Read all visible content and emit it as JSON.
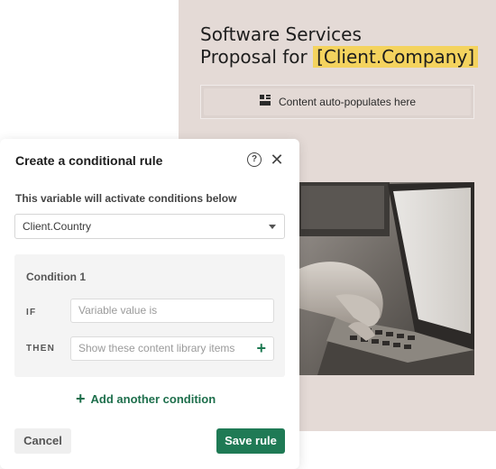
{
  "document": {
    "title_line1": "Software Services",
    "title_line2_prefix": "Proposal for ",
    "title_token": "[Client.Company]",
    "autopopulate_label": "Content auto-populates here"
  },
  "modal": {
    "title": "Create a conditional rule",
    "help_glyph": "?",
    "close_glyph": "✕",
    "variable_prompt": "This variable will activate conditions below",
    "variable_selected": "Client.Country",
    "condition": {
      "title": "Condition 1",
      "if_label": "IF",
      "if_placeholder": "Variable value is",
      "then_label": "THEN",
      "then_placeholder": "Show these content library items"
    },
    "add_condition_label": "Add another condition",
    "cancel_label": "Cancel",
    "save_label": "Save rule"
  },
  "colors": {
    "accent_green": "#1f7a55",
    "token_highlight": "#f4d35e",
    "doc_background": "#e4dad6"
  },
  "icons": {
    "autopopulate": "layout-blocks-icon",
    "help": "help-circle-icon",
    "close": "close-icon",
    "dropdown": "chevron-down-icon",
    "add": "plus-icon"
  }
}
